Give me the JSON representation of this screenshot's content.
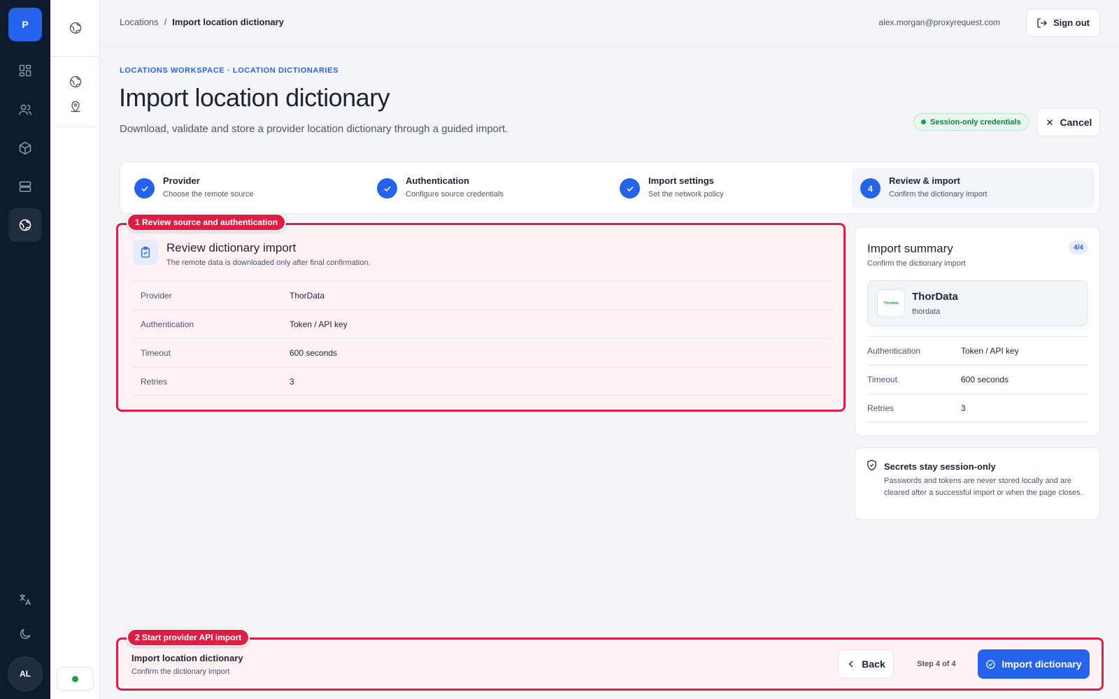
{
  "brand": {
    "logo_letter": "P"
  },
  "rail": {
    "items": [
      "dashboard-icon",
      "users-icon",
      "package-icon",
      "server-icon",
      "globe-icon"
    ],
    "bottom": [
      "translate-icon",
      "moon-icon"
    ],
    "avatar_initials": "AL"
  },
  "breadcrumb": {
    "parent": "Locations",
    "separator": "/",
    "current": "Import location dictionary"
  },
  "user": {
    "email": "alex.morgan@proxyrequest.com",
    "signout_label": "Sign out"
  },
  "header": {
    "eyebrow": "LOCATIONS WORKSPACE · LOCATION DICTIONARIES",
    "title": "Import location dictionary",
    "subtitle": "Download, validate and store a provider location dictionary through a guided import.",
    "session_badge": "Session-only credentials",
    "cancel_label": "Cancel"
  },
  "steps": [
    {
      "label": "Provider",
      "desc": "Choose the remote source",
      "state": "done"
    },
    {
      "label": "Authentication",
      "desc": "Configure source credentials",
      "state": "done"
    },
    {
      "label": "Import settings",
      "desc": "Set the network policy",
      "state": "done"
    },
    {
      "label": "Review & import",
      "desc": "Confirm the dictionary import",
      "state": "active",
      "number": "4"
    }
  ],
  "annotations": {
    "a1": "1 Review source and authentication",
    "a2": "2 Start provider API import"
  },
  "review": {
    "title": "Review dictionary import",
    "subtitle": "The remote data is downloaded only after final confirmation.",
    "rows": [
      {
        "k": "Provider",
        "v": "ThorData"
      },
      {
        "k": "Authentication",
        "v": "Token / API key"
      },
      {
        "k": "Timeout",
        "v": "600 seconds"
      },
      {
        "k": "Retries",
        "v": "3"
      }
    ]
  },
  "summary": {
    "title": "Import summary",
    "subtitle": "Confirm the dictionary import",
    "count": "4/4",
    "provider_name": "ThorData",
    "provider_id": "thordata",
    "provider_logo_text": "Thordata",
    "rows": [
      {
        "k": "Authentication",
        "v": "Token / API key"
      },
      {
        "k": "Timeout",
        "v": "600 seconds"
      },
      {
        "k": "Retries",
        "v": "3"
      }
    ]
  },
  "secret": {
    "title": "Secrets stay session-only",
    "text": "Passwords and tokens are never stored locally and are cleared after a successful import or when the page closes."
  },
  "footer": {
    "title": "Import location dictionary",
    "subtitle": "Confirm the dictionary import",
    "back_label": "Back",
    "step_count": "Step 4 of 4",
    "import_label": "Import dictionary"
  },
  "colors": {
    "accent": "#2563eb",
    "annotation": "#dc1e45",
    "rail": "#0e1a2e",
    "success": "#16a34a"
  }
}
